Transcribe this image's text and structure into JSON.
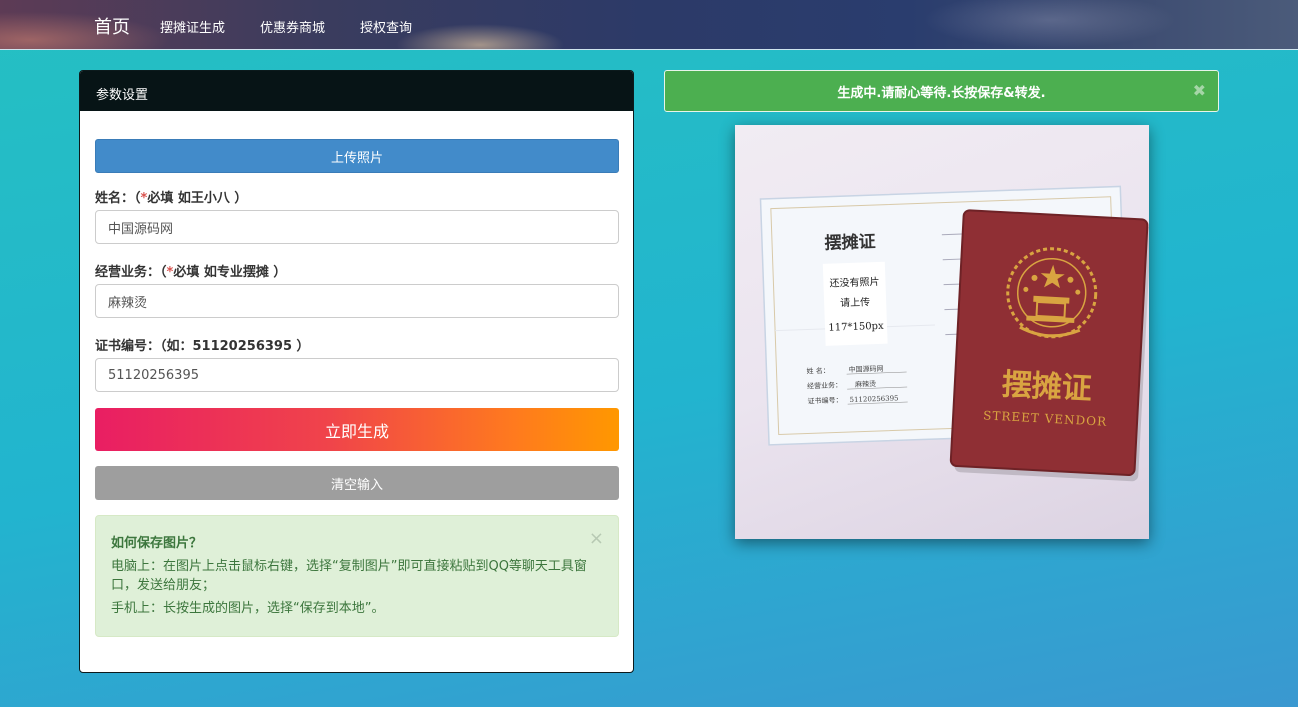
{
  "nav": {
    "brand": "首页",
    "links": [
      "摆摊证生成",
      "优惠券商城",
      "授权查询"
    ]
  },
  "panel": {
    "title": "参数设置",
    "upload_label": "上传照片",
    "fields": [
      {
        "label_prefix": "姓名：（",
        "label_star": "*",
        "label_hint": "必填 如王小八 ）",
        "value": "中国源码网"
      },
      {
        "label_prefix": "经营业务：（",
        "label_star": "*",
        "label_hint": "必填 如专业摆摊 ）",
        "value": "麻辣烫"
      },
      {
        "label_prefix": "证书编号：（如：51120256395 ）",
        "label_star": "",
        "label_hint": "",
        "value": "51120256395"
      }
    ],
    "generate_label": "立即生成",
    "clear_label": "清空输入",
    "help": {
      "title": "如何保存图片？",
      "line1": "电脑上：在图片上点击鼠标右键，选择“复制图片”即可直接粘贴到QQ等聊天工具窗口，发送给朋友；",
      "line2": "手机上：长按生成的图片，选择“保存到本地”。",
      "close": "×"
    }
  },
  "status": {
    "text": "生成中.请耐心等待.长按保存&转发.",
    "close": "✖"
  },
  "certificate": {
    "inner_title": "摆摊证",
    "photo_line1": "还没有照片",
    "photo_line2": "请上传",
    "photo_line3": "117*150px",
    "name_label": "姓    名：",
    "name_value": "中国源码网",
    "business_label": "经营业务：",
    "business_value": "麻辣烫",
    "number_label": "证书编号：",
    "number_value": "51120256395",
    "cover_title": "摆摊证",
    "cover_subtitle": "STREET VENDOR",
    "colors": {
      "cover": "#8f2f34",
      "gold": "#d9a441"
    }
  },
  "icons": [
    "close-icon",
    "emblem-icon"
  ]
}
